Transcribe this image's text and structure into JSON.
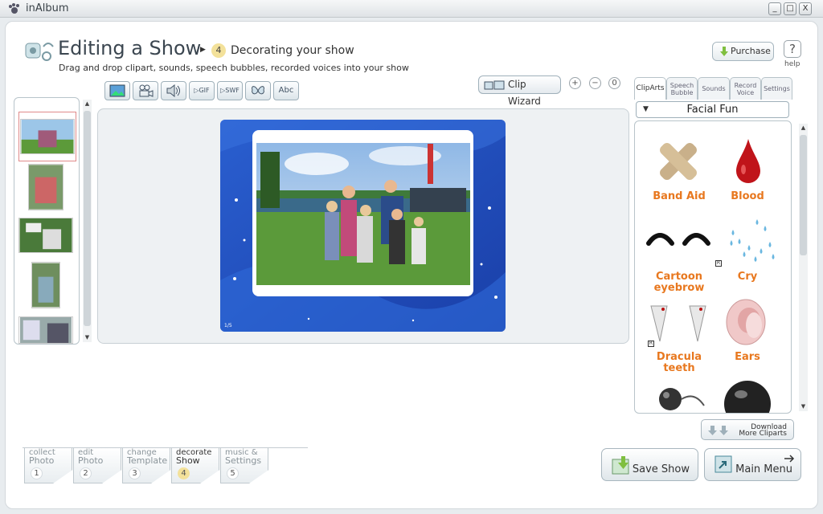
{
  "window": {
    "title": "inAlbum",
    "minimize": "_",
    "maximize": "□",
    "close": "X"
  },
  "header": {
    "title": "Editing a Show",
    "step_number": "4",
    "subtitle": "Decorating your show",
    "description": "Drag and drop clipart, sounds, speech bubbles, recorded voices into your show",
    "purchase_label": "Purchase",
    "help_glyph": "?",
    "help_label": "help"
  },
  "toolbar": {
    "tools": [
      {
        "name": "photo-tool",
        "label": ""
      },
      {
        "name": "video-tool",
        "label": ""
      },
      {
        "name": "sound-tool",
        "label": ""
      },
      {
        "name": "gif-tool",
        "label": "GIF"
      },
      {
        "name": "swf-tool",
        "label": "SWF"
      },
      {
        "name": "butterfly-tool",
        "label": ""
      },
      {
        "name": "text-tool",
        "label": "Abc"
      }
    ],
    "clip_wizard_label": "Clip Wizard",
    "zoom_in": "+",
    "zoom_out": "−",
    "zoom_reset": "0"
  },
  "slide": {
    "counter": "1/5"
  },
  "clip_panel": {
    "tabs": [
      "ClipArts",
      "Speech Bubble",
      "Sounds",
      "Record Voice",
      "Settings"
    ],
    "active_tab": "ClipArts",
    "category": "Facial Fun",
    "clips": [
      "Band Aid",
      "Blood",
      "Cartoon eyebrow",
      "Cry",
      "Dracula teeth",
      "Ears"
    ],
    "badge": "R",
    "download_line1": "Download",
    "download_line2": "More Cliparts"
  },
  "steps": [
    {
      "small": "collect",
      "large": "Photo",
      "num": "1"
    },
    {
      "small": "edit",
      "large": "Photo",
      "num": "2"
    },
    {
      "small": "change",
      "large": "Template",
      "num": "3"
    },
    {
      "small": "decorate",
      "large": "Show",
      "num": "4"
    },
    {
      "small": "music &",
      "large": "Settings",
      "num": "5"
    }
  ],
  "active_step": "4",
  "buttons": {
    "save_show": "Save Show",
    "main_menu": "Main Menu"
  },
  "colors": {
    "accent_orange": "#e8781f",
    "slide_blue": "#1f4fc4",
    "step_highlight": "#f3e19a"
  }
}
